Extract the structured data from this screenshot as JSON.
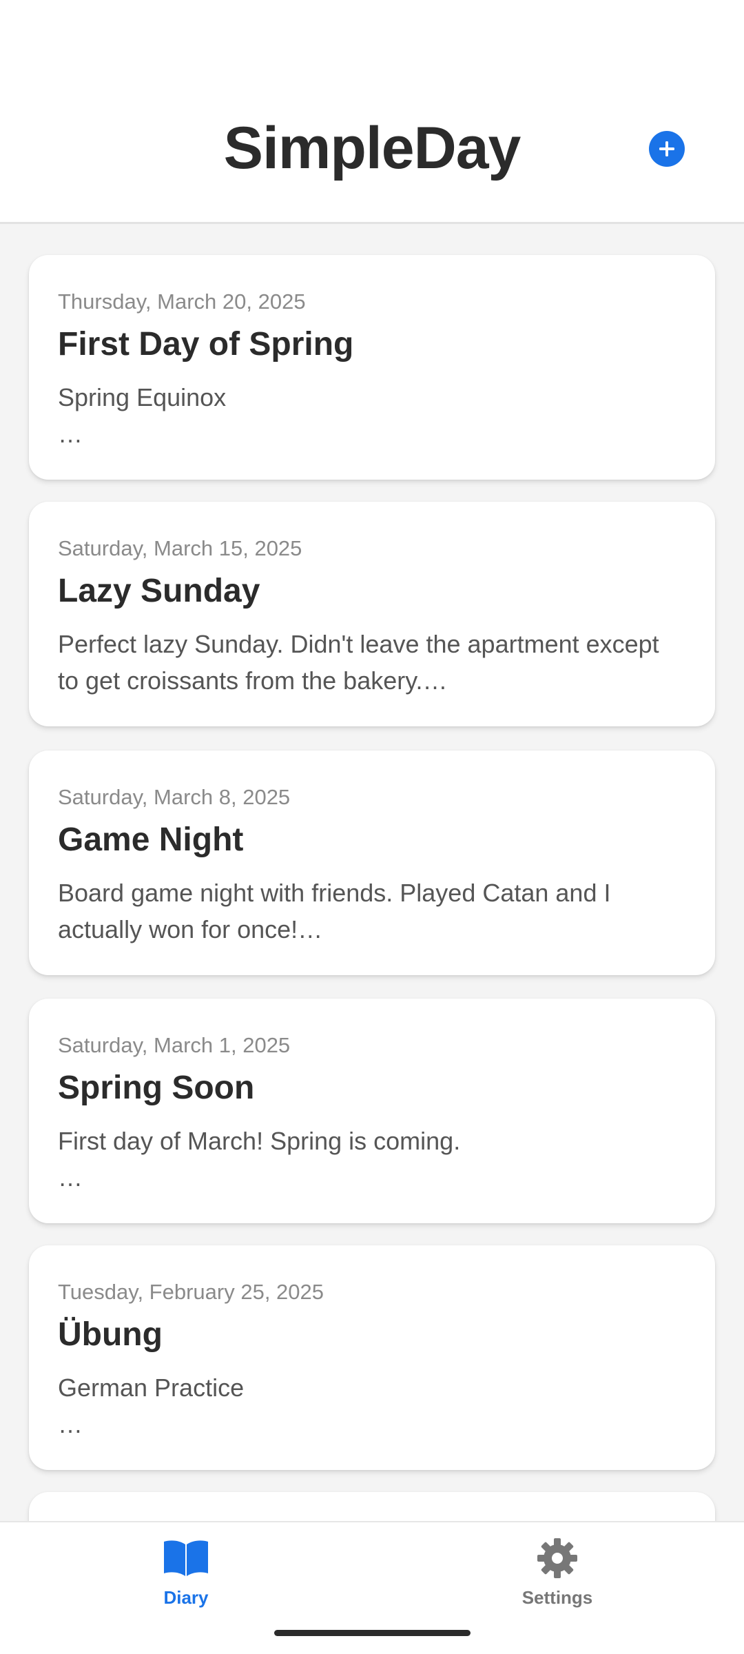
{
  "header": {
    "title": "SimpleDay",
    "add_icon": "plus-circle-icon",
    "accent_color": "#1a73e8"
  },
  "entries": [
    {
      "date": "Thursday, March 20, 2025",
      "title": "First Day of Spring",
      "preview": "Spring Equinox\n…"
    },
    {
      "date": "Saturday, March 15, 2025",
      "title": "Lazy Sunday",
      "preview": "Perfect lazy Sunday. Didn't leave the apartment except to get croissants from the bakery.…"
    },
    {
      "date": "Saturday, March 8, 2025",
      "title": "Game Night",
      "preview": "Board game night with friends. Played Catan and I actually won for once!…"
    },
    {
      "date": "Saturday, March 1, 2025",
      "title": "Spring Soon",
      "preview": "First day of March! Spring is coming.\n…"
    },
    {
      "date": "Tuesday, February 25, 2025",
      "title": "Übung",
      "preview": "German Practice\n…"
    }
  ],
  "nav": {
    "diary": {
      "label": "Diary",
      "icon": "book-open-icon",
      "active": true
    },
    "settings": {
      "label": "Settings",
      "icon": "gear-icon",
      "active": false
    }
  }
}
